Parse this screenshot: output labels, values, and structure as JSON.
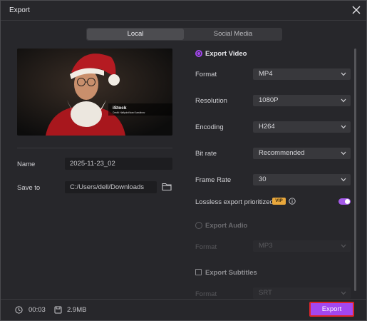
{
  "window": {
    "title": "Export"
  },
  "tabs": [
    {
      "label": "Local"
    },
    {
      "label": "Social Media"
    }
  ],
  "preview": {
    "watermark_title": "iStock",
    "watermark_sub": "Credit: Halfpoint/Ivan Kuvshinov"
  },
  "left": {
    "name_label": "Name",
    "name_value": "2025-11-23_02",
    "save_label": "Save to",
    "save_value": "C:/Users/dell/Downloads"
  },
  "export_video": {
    "label": "Export Video",
    "format_label": "Format",
    "format_value": "MP4",
    "resolution_label": "Resolution",
    "resolution_value": "1080P",
    "encoding_label": "Encoding",
    "encoding_value": "H264",
    "bitrate_label": "Bit rate",
    "bitrate_value": "Recommended",
    "framerate_label": "Frame Rate",
    "framerate_value": "30",
    "lossless_label": "Lossless export prioritized",
    "vip_badge": "VIP"
  },
  "export_audio": {
    "label": "Export Audio",
    "format_label": "Format",
    "format_value": "MP3"
  },
  "export_subtitles": {
    "label": "Export Subtitles",
    "format_label": "Format",
    "format_value": "SRT"
  },
  "bottom": {
    "duration": "00:03",
    "size": "2.9MB",
    "export_label": "Export"
  },
  "colors": {
    "accent": "#a347f0",
    "highlight_border": "#e0242a",
    "vip": "#e9a83c"
  }
}
